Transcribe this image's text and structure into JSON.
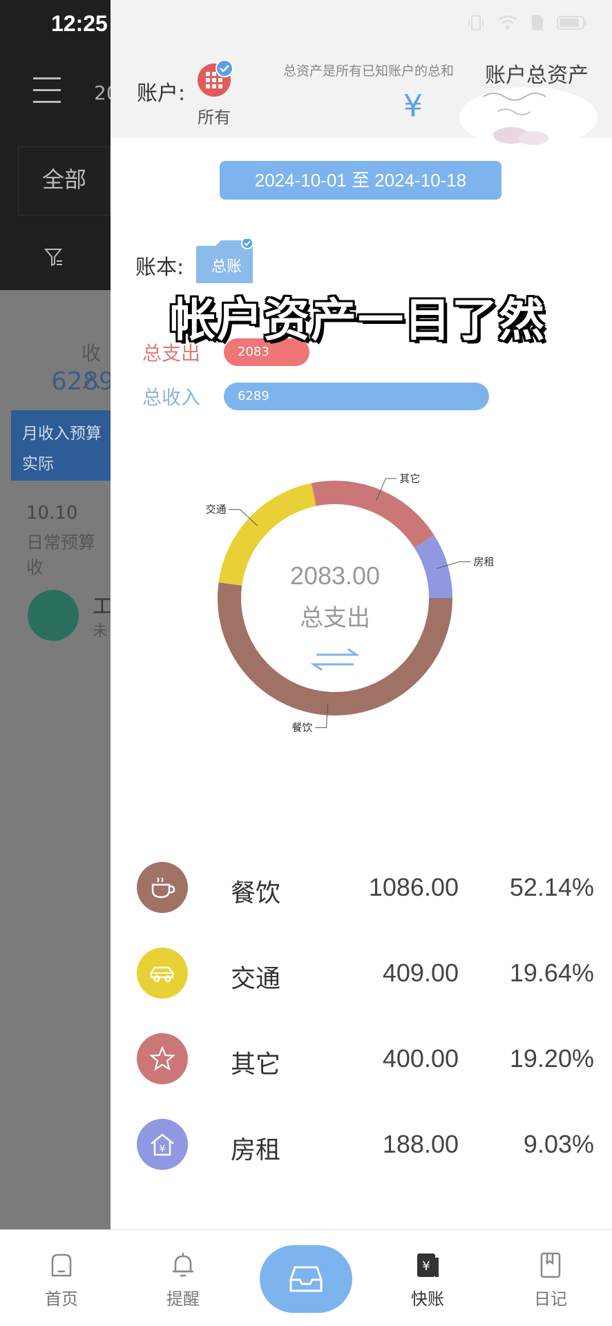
{
  "status": {
    "time": "12:25"
  },
  "background": {
    "year_fragment": "20",
    "tab_all": "全部",
    "income_label": "收入",
    "income_value": "6289",
    "budget_line1": "月收入预算",
    "budget_line2": "实际",
    "date": "10.10",
    "daily_budget": "日常预算收",
    "item_title": "工",
    "item_sub": "未"
  },
  "drawer": {
    "account_label": "账户:",
    "account_value": "所有",
    "asset_hint": "总资产是所有已知账户的总和",
    "asset_title": "账户总资产",
    "currency": "¥",
    "date_range": "2024-10-01 至 2024-10-18",
    "book_label": "账本:",
    "book_name": "总账",
    "overlay_caption": "帐户资产一目了然",
    "total_expense_label": "总支出",
    "total_expense_value": "2083",
    "total_income_label": "总收入",
    "total_income_value": "6289",
    "donut_center_value": "2083.00",
    "donut_center_label": "总支出"
  },
  "colors": {
    "dining": "#a07266",
    "transport": "#e8d136",
    "other": "#cc7777",
    "rent": "#9098e2",
    "accent": "#7db4ee"
  },
  "chart_data": {
    "type": "pie",
    "categories": [
      "餐饮",
      "交通",
      "其它",
      "房租"
    ],
    "values": [
      1086.0,
      409.0,
      400.0,
      188.0
    ],
    "percent": [
      52.14,
      19.64,
      19.2,
      9.03
    ]
  },
  "categories": [
    {
      "name": "餐饮",
      "amount": "1086.00",
      "percent": "52.14%",
      "icon": "coffee-cup-icon"
    },
    {
      "name": "交通",
      "amount": "409.00",
      "percent": "19.64%",
      "icon": "car-icon"
    },
    {
      "name": "其它",
      "amount": "400.00",
      "percent": "19.20%",
      "icon": "star-icon"
    },
    {
      "name": "房租",
      "amount": "188.00",
      "percent": "9.03%",
      "icon": "house-yen-icon"
    }
  ],
  "tabbar": {
    "home": "首页",
    "remind": "提醒",
    "quick": "快账",
    "diary": "日记"
  }
}
